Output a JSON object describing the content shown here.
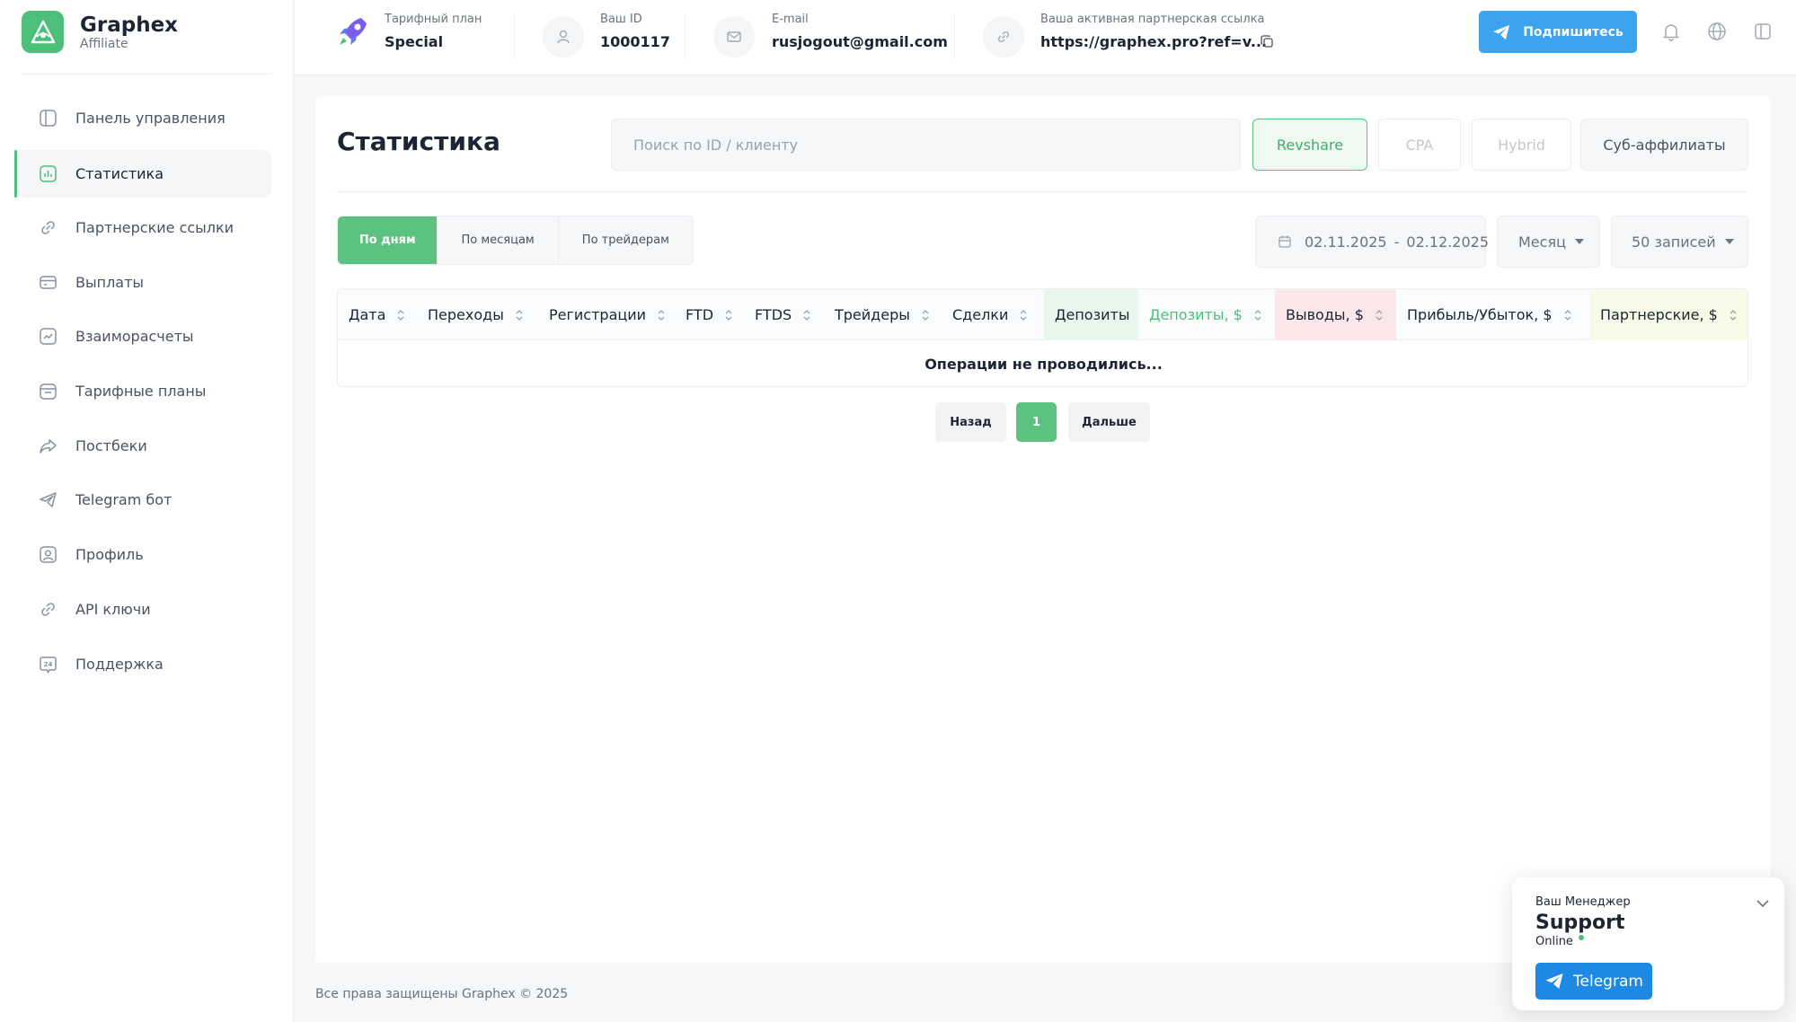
{
  "brand": {
    "name": "Graphex",
    "sub": "Affiliate"
  },
  "sidebar": {
    "items": [
      {
        "label": "Панель управления",
        "icon": "dashboard-icon"
      },
      {
        "label": "Статистика",
        "icon": "statistics-icon"
      },
      {
        "label": "Партнерские ссылки",
        "icon": "link-icon"
      },
      {
        "label": "Выплаты",
        "icon": "payout-card-icon"
      },
      {
        "label": "Взаиморасчеты",
        "icon": "settlements-chart-icon"
      },
      {
        "label": "Тарифные планы",
        "icon": "tariff-icon"
      },
      {
        "label": "Постбеки",
        "icon": "postback-share-icon"
      },
      {
        "label": "Telegram бот",
        "icon": "telegram-icon"
      },
      {
        "label": "Профиль",
        "icon": "profile-icon"
      },
      {
        "label": "API ключи",
        "icon": "api-key-icon"
      },
      {
        "label": "Поддержка",
        "icon": "support-24-icon"
      }
    ],
    "active_index": 1
  },
  "header": {
    "plan_caption": "Тарифный план",
    "plan_value": "Special",
    "id_caption": "Ваш ID",
    "id_value": "1000117",
    "email_caption": "E-mail",
    "email_value": "rusjogout@gmail.com",
    "link_caption": "Ваша активная партнерская ссылка",
    "link_value": "https://graphex.pro?ref=v...",
    "subscribe_label": "Подпишитесь"
  },
  "main": {
    "title": "Статистика",
    "search_placeholder": "Поиск по ID / клиенту",
    "filters": [
      {
        "label": "Revshare",
        "state": "active"
      },
      {
        "label": "CPA",
        "state": "disabled"
      },
      {
        "label": "Hybrid",
        "state": "disabled"
      },
      {
        "label": "Суб-аффилиаты",
        "state": "normal"
      }
    ],
    "period_tabs": [
      {
        "label": "По дням",
        "active": true
      },
      {
        "label": "По месяцам",
        "active": false
      },
      {
        "label": "По трейдерам",
        "active": false
      }
    ],
    "date_from": "02.11.2025",
    "date_sep": "-",
    "date_to": "02.12.2025",
    "group_select": "Месяц",
    "page_size_select": "50 записей"
  },
  "table": {
    "columns": [
      {
        "label": "Дата",
        "sortable": true
      },
      {
        "label": "Переходы",
        "sortable": true
      },
      {
        "label": "Регистрации",
        "sortable": true
      },
      {
        "label": "FTD",
        "sortable": true
      },
      {
        "label": "FTDS",
        "sortable": true
      },
      {
        "label": "Трейдеры",
        "sortable": true
      },
      {
        "label": "Сделки",
        "sortable": true
      },
      {
        "label": "Депозиты",
        "sortable": false
      },
      {
        "label": "Депозиты, $",
        "sortable": true
      },
      {
        "label": "Выводы, $",
        "sortable": true
      },
      {
        "label": "Прибыль/Убыток, $",
        "sortable": true
      },
      {
        "label": "Партнерские, $",
        "sortable": true
      }
    ],
    "empty_text": "Операции не проводились..."
  },
  "pagination": {
    "prev": "Назад",
    "current": "1",
    "next": "Дальше"
  },
  "footer": {
    "text": "Все права защищены Graphex © 2025"
  },
  "manager": {
    "caption": "Ваш Менеджер",
    "name": "Support",
    "status": "Online",
    "button": "Telegram"
  },
  "colors": {
    "accent": "#5cc27f",
    "blue": "#3ba3ef",
    "telegram": "#1e88e5",
    "deposits_bg": "#e8f6ee",
    "withdraw_bg": "#fbe6e9",
    "partner_bg": "#f7fae6"
  }
}
